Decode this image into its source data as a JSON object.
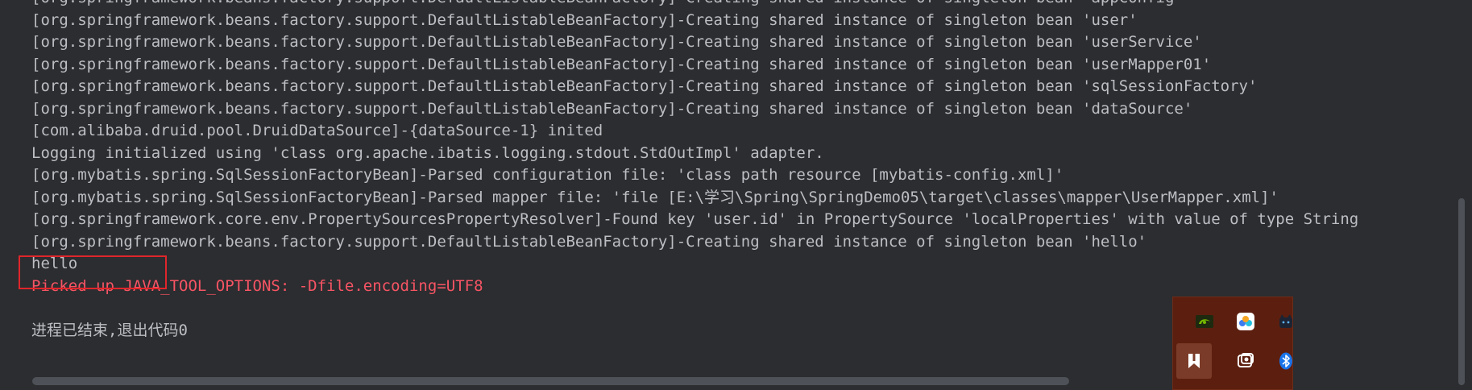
{
  "console": {
    "lines": [
      {
        "text": "[org.springframework.beans.factory.support.DefaultListableBeanFactory]-Creating shared instance of singleton bean 'appConfig'",
        "kind": "normal"
      },
      {
        "text": "[org.springframework.beans.factory.support.DefaultListableBeanFactory]-Creating shared instance of singleton bean 'user'",
        "kind": "normal"
      },
      {
        "text": "[org.springframework.beans.factory.support.DefaultListableBeanFactory]-Creating shared instance of singleton bean 'userService'",
        "kind": "normal"
      },
      {
        "text": "[org.springframework.beans.factory.support.DefaultListableBeanFactory]-Creating shared instance of singleton bean 'userMapper01'",
        "kind": "normal"
      },
      {
        "text": "[org.springframework.beans.factory.support.DefaultListableBeanFactory]-Creating shared instance of singleton bean 'sqlSessionFactory'",
        "kind": "normal"
      },
      {
        "text": "[org.springframework.beans.factory.support.DefaultListableBeanFactory]-Creating shared instance of singleton bean 'dataSource'",
        "kind": "normal"
      },
      {
        "text": "[com.alibaba.druid.pool.DruidDataSource]-{dataSource-1} inited",
        "kind": "normal"
      },
      {
        "text": "Logging initialized using 'class org.apache.ibatis.logging.stdout.StdOutImpl' adapter.",
        "kind": "normal"
      },
      {
        "text": "[org.mybatis.spring.SqlSessionFactoryBean]-Parsed configuration file: 'class path resource [mybatis-config.xml]'",
        "kind": "normal"
      },
      {
        "text": "[org.mybatis.spring.SqlSessionFactoryBean]-Parsed mapper file: 'file [E:\\学习\\Spring\\SpringDemo05\\target\\classes\\mapper\\UserMapper.xml]'",
        "kind": "normal"
      },
      {
        "text": "[org.springframework.core.env.PropertySourcesPropertyResolver]-Found key 'user.id' in PropertySource 'localProperties' with value of type String",
        "kind": "normal"
      },
      {
        "text": "[org.springframework.beans.factory.support.DefaultListableBeanFactory]-Creating shared instance of singleton bean 'hello'",
        "kind": "normal"
      },
      {
        "text": "hello",
        "kind": "normal"
      },
      {
        "text": "Picked up JAVA_TOOL_OPTIONS: -Dfile.encoding=UTF8",
        "kind": "err"
      },
      {
        "text": "",
        "kind": "blank"
      },
      {
        "text": "进程已结束,退出代码0",
        "kind": "normal"
      }
    ]
  },
  "colors": {
    "background": "#2b2d30",
    "text": "#bcbec4",
    "error_text": "#f75464",
    "highlight_border": "#e0262b",
    "tray_background": "#5c1f0f"
  },
  "tray": {
    "icons": [
      {
        "name": "nvidia-icon"
      },
      {
        "name": "cloud-sync-icon"
      },
      {
        "name": "cat-app-icon"
      },
      {
        "name": "bookmark-app-icon",
        "selected": true
      },
      {
        "name": "screenshot-app-icon"
      },
      {
        "name": "bluetooth-icon"
      }
    ]
  }
}
